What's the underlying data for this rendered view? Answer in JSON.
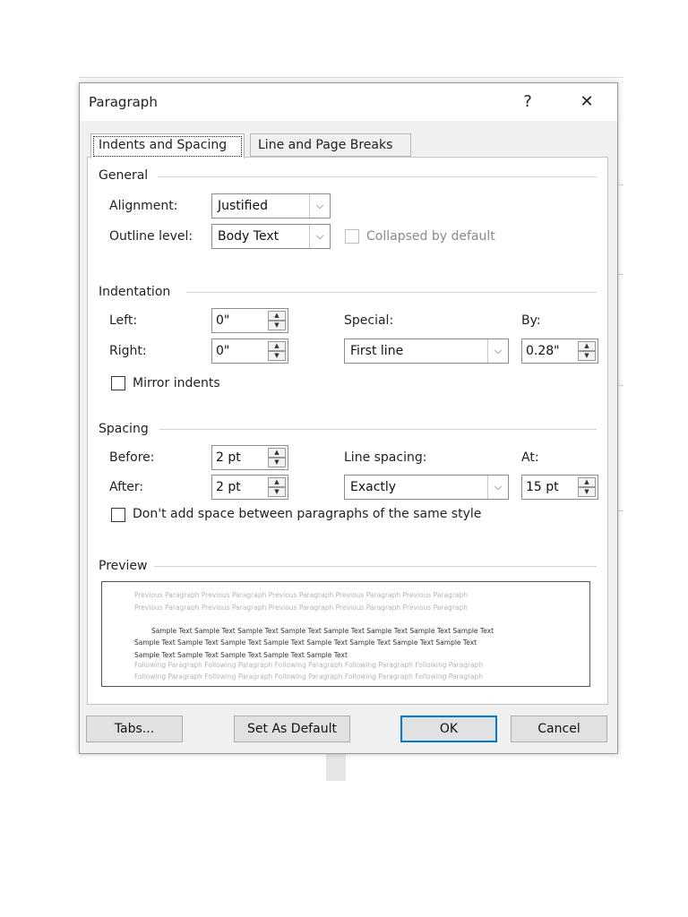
{
  "dialog": {
    "title": "Paragraph",
    "help_icon": "help-icon",
    "close_icon": "close-icon",
    "help_glyph": "?",
    "close_glyph": "✕"
  },
  "tabs": [
    {
      "label": "Indents and Spacing",
      "selected": true
    },
    {
      "label": "Line and Page Breaks",
      "selected": false
    }
  ],
  "general": {
    "heading": "General",
    "alignment_label": "Alignment:",
    "alignment_value": "Justified",
    "outline_label": "Outline level:",
    "outline_value": "Body Text",
    "collapsed_label": "Collapsed by default"
  },
  "indentation": {
    "heading": "Indentation",
    "left_label": "Left:",
    "left_value": "0\"",
    "right_label": "Right:",
    "right_value": "0\"",
    "special_label": "Special:",
    "special_value": "First line",
    "by_label": "By:",
    "by_value": "0.28\"",
    "mirror_label": "Mirror indents"
  },
  "spacing": {
    "heading": "Spacing",
    "before_label": "Before:",
    "before_value": "2 pt",
    "after_label": "After:",
    "after_value": "2 pt",
    "line_spacing_label": "Line spacing:",
    "line_spacing_value": "Exactly",
    "at_label": "At:",
    "at_value": "15 pt",
    "dont_add_label": "Don't add space between paragraphs of the same style"
  },
  "preview": {
    "heading": "Preview",
    "lines": [
      "Previous Paragraph Previous Paragraph Previous Paragraph Previous Paragraph Previous Paragraph",
      "Previous Paragraph Previous Paragraph Previous Paragraph Previous Paragraph Previous Paragraph",
      "Sample Text Sample Text Sample Text Sample Text Sample Text Sample Text Sample Text Sample Text",
      "Sample Text Sample Text Sample Text Sample Text Sample Text Sample Text Sample Text Sample Text",
      "Sample Text Sample Text Sample Text Sample Text Sample Text",
      "Following Paragraph Following Paragraph Following Paragraph Following Paragraph Following Paragraph",
      "Following Paragraph Following Paragraph Following Paragraph Following Paragraph Following Paragraph"
    ]
  },
  "buttons": {
    "tabs": "Tabs...",
    "set_default": "Set As Default",
    "ok": "OK",
    "cancel": "Cancel"
  },
  "colors": {
    "ok_border": "#0078d7",
    "dialog_bg": "#f0f0f0"
  }
}
